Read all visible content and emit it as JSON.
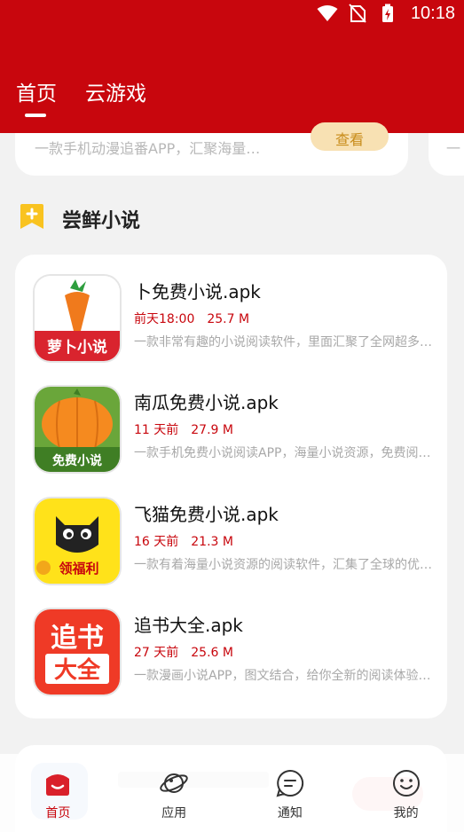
{
  "status_bar": {
    "time": "10:18"
  },
  "tabs": [
    {
      "label": "首页",
      "active": true
    },
    {
      "label": "云游戏",
      "active": false
    }
  ],
  "prev_card": {
    "desc": "一款手机动漫追番APP，汇聚海量…",
    "button": "查看"
  },
  "section": {
    "title": "尝鲜小说"
  },
  "apps": [
    {
      "name": "卜免费小说.apk",
      "date": "前天18:00",
      "size": "25.7 M",
      "desc": "一款非常有趣的小说阅读软件，里面汇聚了全网超多…",
      "icon_text": "萝卜小说"
    },
    {
      "name": "南瓜免费小说.apk",
      "date": "11 天前",
      "size": "27.9 M",
      "desc": "一款手机免费小说阅读APP，海量小说资源，免费阅…",
      "icon_text": "免费小说"
    },
    {
      "name": "飞猫免费小说.apk",
      "date": "16 天前",
      "size": "21.3 M",
      "desc": "一款有着海量小说资源的阅读软件，汇集了全球的优…",
      "icon_text": "领福利"
    },
    {
      "name": "追书大全.apk",
      "date": "27 天前",
      "size": "25.6 M",
      "desc": "一款漫画小说APP，图文结合，给你全新的阅读体验…",
      "icon_text_1": "追书",
      "icon_text_2": "大全"
    }
  ],
  "bottom_nav": [
    {
      "label": "首页",
      "icon": "home-icon",
      "active": true
    },
    {
      "label": "应用",
      "icon": "planet-icon",
      "active": false
    },
    {
      "label": "通知",
      "icon": "message-icon",
      "active": false
    },
    {
      "label": "我的",
      "icon": "smile-icon",
      "active": false
    }
  ],
  "colors": {
    "brand": "#c8060d",
    "accent_button": "#f8e1b3",
    "section_icon": "#f9c320"
  }
}
